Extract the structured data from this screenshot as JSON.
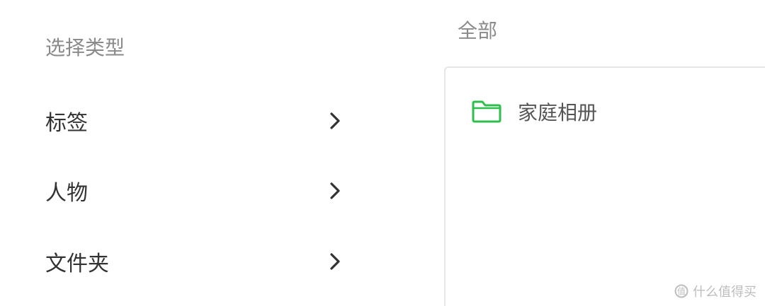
{
  "left_panel": {
    "title": "选择类型",
    "items": [
      {
        "label": "标签"
      },
      {
        "label": "人物"
      },
      {
        "label": "文件夹"
      }
    ]
  },
  "right_panel": {
    "header": "全部",
    "folders": [
      {
        "name": "家庭相册",
        "icon": "folder-icon"
      }
    ]
  },
  "watermark": {
    "text": "什么值得买"
  },
  "colors": {
    "folder_green": "#2dbe4e",
    "chevron": "#333333",
    "muted_text": "#8a8a8a",
    "border": "#e6e6e6"
  }
}
